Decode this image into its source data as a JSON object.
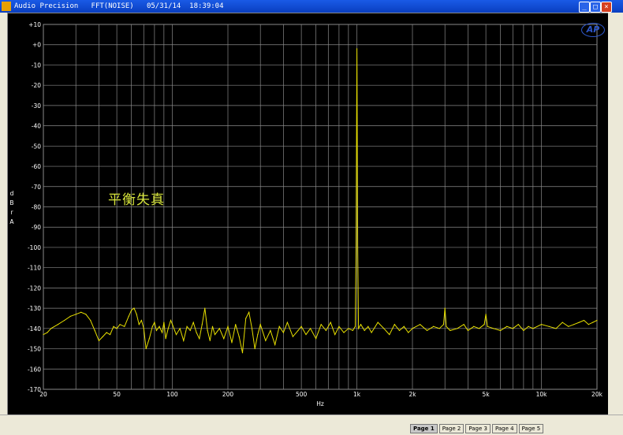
{
  "window": {
    "title": "Audio Precision   FFT(NOISE)   05/31/14  18:39:04",
    "minimize_label": "_",
    "maximize_label": "□",
    "close_label": "×"
  },
  "logo": "AP",
  "annotation": "平衡失真",
  "page_tabs": [
    "Page 1",
    "Page 2",
    "Page 3",
    "Page 4",
    "Page 5"
  ],
  "colors": {
    "trace": "#e8e000",
    "grid": "#8a8a8a",
    "plot_bg": "#000000",
    "annotation": "#d4e23a"
  },
  "chart_data": {
    "type": "line",
    "title": "",
    "xlabel": "Hz",
    "ylabel": "dBr A",
    "x_scale": "log",
    "xlim": [
      20,
      20000
    ],
    "ylim": [
      -170,
      10
    ],
    "x_ticks": [
      20,
      50,
      100,
      200,
      500,
      1000,
      2000,
      5000,
      10000,
      20000
    ],
    "x_tick_labels": [
      "20",
      "50",
      "100",
      "200",
      "500",
      "1k",
      "2k",
      "5k",
      "10k",
      "20k"
    ],
    "y_ticks": [
      10,
      0,
      -10,
      -20,
      -30,
      -40,
      -50,
      -60,
      -70,
      -80,
      -90,
      -100,
      -110,
      -120,
      -130,
      -140,
      -150,
      -160,
      -170
    ],
    "y_tick_labels": [
      "+10",
      "+0",
      "-10",
      "-20",
      "-30",
      "-40",
      "-50",
      "-60",
      "-70",
      "-80",
      "-90",
      "-100",
      "-110",
      "-120",
      "-130",
      "-140",
      "-150",
      "-160",
      "-170"
    ],
    "grid": true,
    "series": [
      {
        "x": [
          20,
          21,
          22,
          24,
          26,
          28,
          30,
          32,
          34,
          36,
          38,
          40,
          42,
          44,
          46,
          48,
          50,
          52,
          55,
          58,
          60,
          62,
          64,
          66,
          68,
          70,
          72,
          75,
          78,
          80,
          82,
          85,
          88,
          90,
          92,
          95,
          98,
          100,
          105,
          110,
          115,
          120,
          125,
          130,
          135,
          140,
          145,
          150,
          155,
          160,
          165,
          170,
          180,
          190,
          200,
          210,
          220,
          230,
          240,
          250,
          260,
          270,
          280,
          290,
          300,
          320,
          340,
          360,
          380,
          400,
          420,
          450,
          480,
          500,
          530,
          560,
          600,
          640,
          680,
          720,
          760,
          800,
          850,
          900,
          950,
          980,
          990,
          1000,
          1010,
          1020,
          1050,
          1100,
          1150,
          1200,
          1300,
          1400,
          1500,
          1600,
          1700,
          1800,
          1900,
          2000,
          2200,
          2400,
          2600,
          2800,
          2950,
          3000,
          3050,
          3200,
          3500,
          3800,
          4000,
          4300,
          4600,
          4900,
          5000,
          5100,
          5500,
          6000,
          6500,
          7000,
          7500,
          8000,
          8500,
          9000,
          10000,
          11000,
          12000,
          13000,
          14000,
          15000,
          16000,
          17000,
          18000,
          19000,
          20000
        ],
        "y": [
          -143,
          -142,
          -140,
          -138,
          -136,
          -134,
          -133,
          -132,
          -133,
          -136,
          -141,
          -146,
          -144,
          -142,
          -143,
          -139,
          -140,
          -138,
          -139,
          -134,
          -131,
          -130,
          -133,
          -138,
          -136,
          -140,
          -150,
          -145,
          -139,
          -137,
          -141,
          -139,
          -142,
          -137,
          -145,
          -140,
          -136,
          -138,
          -143,
          -140,
          -146,
          -139,
          -141,
          -137,
          -142,
          -145,
          -138,
          -130,
          -141,
          -146,
          -139,
          -143,
          -140,
          -145,
          -139,
          -147,
          -138,
          -144,
          -152,
          -135,
          -132,
          -140,
          -150,
          -143,
          -138,
          -146,
          -141,
          -148,
          -139,
          -142,
          -137,
          -144,
          -141,
          -139,
          -143,
          -140,
          -145,
          -138,
          -141,
          -137,
          -143,
          -139,
          -142,
          -140,
          -141,
          -139,
          -100,
          -2,
          -100,
          -140,
          -138,
          -141,
          -139,
          -142,
          -137,
          -140,
          -143,
          -138,
          -141,
          -139,
          -142,
          -140,
          -138,
          -141,
          -139,
          -140,
          -138,
          -130,
          -139,
          -141,
          -140,
          -138,
          -141,
          -139,
          -140,
          -138,
          -133,
          -139,
          -140,
          -141,
          -139,
          -140,
          -138,
          -141,
          -139,
          -140,
          -138,
          -139,
          -140,
          -137,
          -139,
          -138,
          -137,
          -136,
          -138,
          -137,
          -136
        ]
      }
    ]
  }
}
